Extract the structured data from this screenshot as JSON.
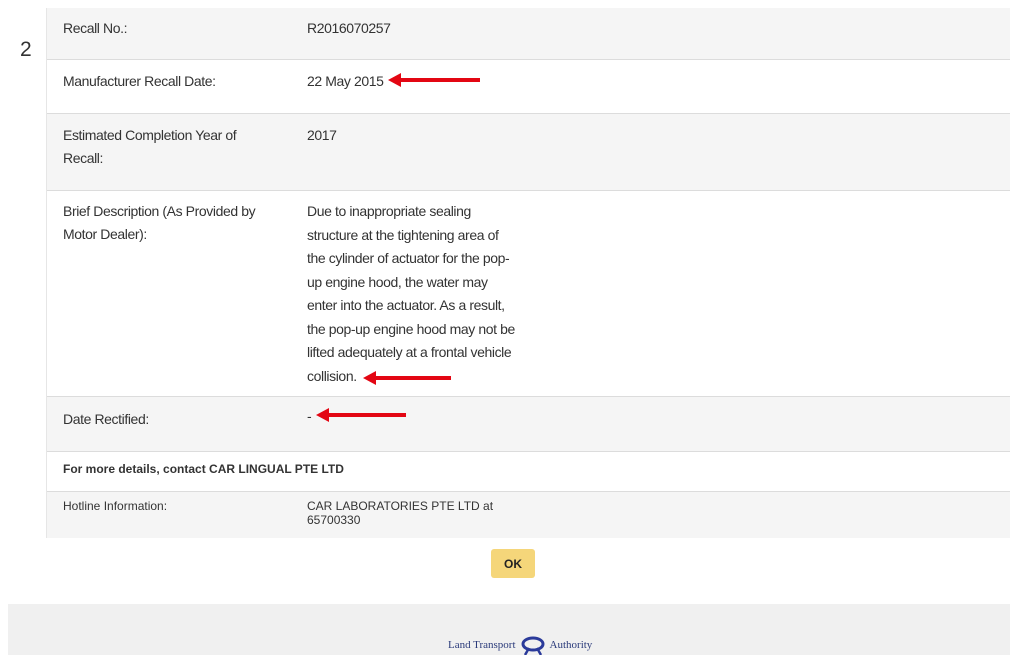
{
  "record": {
    "index": "2",
    "recall_no_label": "Recall No.:",
    "recall_no_value": "R2016070257",
    "manufacturer_date_label": "Manufacturer Recall Date:",
    "manufacturer_date_value": "22 May 2015",
    "completion_label_1": "Estimated Completion Year of",
    "completion_label_2": "Recall:",
    "completion_value": "2017",
    "description_label_1": "Brief Description (As Provided by",
    "description_label_2": "Motor Dealer):",
    "description_lines": [
      "Due to inappropriate sealing",
      "structure at the tightening area of",
      "the cylinder of actuator for the pop-",
      "up engine hood, the water may",
      "enter into the actuator. As a result,",
      "the pop-up engine hood may not be",
      "lifted adequately at a frontal vehicle",
      "collision."
    ],
    "date_rectified_label": "Date Rectified:",
    "date_rectified_value": "-"
  },
  "contact": {
    "heading": "For more details, contact CAR LINGUAL PTE LTD",
    "hotline_label": "Hotline Information:",
    "hotline_value_1": "CAR LABORATORIES PTE LTD at",
    "hotline_value_2": "65700330"
  },
  "actions": {
    "ok_label": "OK"
  },
  "footer": {
    "logo_left": "Land Transport",
    "logo_right": "Authority"
  },
  "colors": {
    "arrow": "#e30613",
    "ok_button": "#f5d67a",
    "row_shade": "#f5f5f5"
  }
}
